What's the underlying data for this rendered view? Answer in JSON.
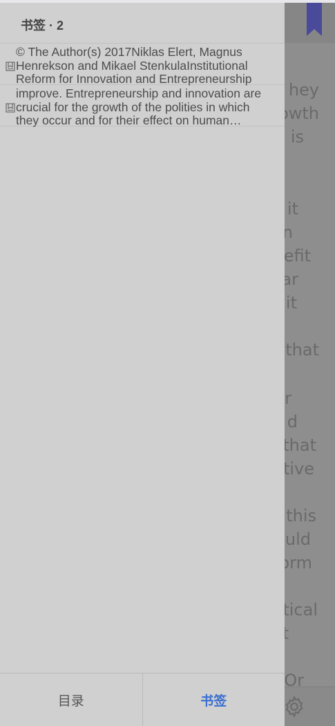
{
  "drawer": {
    "title": "书签 · 2",
    "bookmarks": [
      {
        "text": "© The Author(s) 2017Niklas Elert, Magnus Henrekson and Mikael StenkulaInstitutional Reform for Innovation and Entrepreneurship"
      },
      {
        "text": "improve. Entrepreneurship and innovation are crucial for the growth of the polities in which they occur and for their effect on human welfare"
      }
    ],
    "tabs": [
      {
        "label": "目录",
        "active": false
      },
      {
        "label": "书签",
        "active": true
      }
    ]
  },
  "reader": {
    "line_fragments": [
      "hey",
      "owth",
      "is",
      "it",
      "n",
      "efit",
      "ar",
      "it",
      "that",
      "r",
      "d",
      "that",
      "tive",
      "this",
      "uld",
      "orm",
      "tical",
      "t",
      "Or"
    ]
  },
  "colors": {
    "accent": "#3a6fd0",
    "ribbon": "#4a4a9a",
    "drawer_bg": "#d0d0d0"
  },
  "icons": {
    "bookmark": "bookmark-small-icon",
    "ribbon": "bookmark-ribbon-icon",
    "settings": "gear-icon"
  }
}
